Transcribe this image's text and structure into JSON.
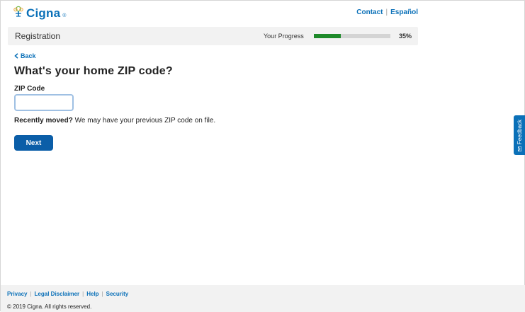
{
  "header": {
    "brand": "Cigna",
    "brand_mark": "®",
    "logo_icon": "tree-person-icon",
    "links": [
      "Contact",
      "Español"
    ]
  },
  "progress_bar": {
    "title": "Registration",
    "label": "Your Progress",
    "percent_value": 35,
    "percent_text": "35%",
    "fill_color": "#1e8a2a"
  },
  "main": {
    "back_label": "Back",
    "title": "What's your home ZIP code?",
    "zip_label": "ZIP Code",
    "zip_value": "",
    "zip_placeholder": "",
    "moved_bold": "Recently moved?",
    "moved_text": " We may have your previous ZIP code on file.",
    "next_label": "Next"
  },
  "feedback": {
    "label": "Feedback",
    "icon": "envelope-icon"
  },
  "footer": {
    "links": [
      "Privacy",
      "Legal Disclaimer",
      "Help",
      "Security"
    ],
    "copyright": "© 2019 Cigna. All rights reserved."
  },
  "colors": {
    "brand_blue": "#0a70b8",
    "button_blue": "#0b5ea8",
    "progress_green": "#1e8a2a"
  }
}
